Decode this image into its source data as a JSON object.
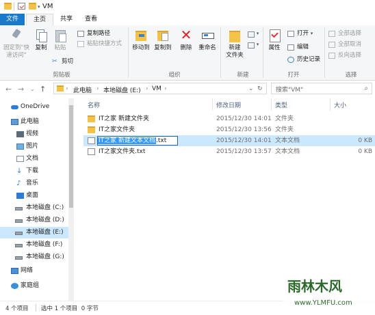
{
  "window": {
    "title": "VM"
  },
  "ribbon_tabs": [
    "文件",
    "主页",
    "共享",
    "查看"
  ],
  "ribbon": {
    "clipboard": {
      "pin_label": "固定到\"快\n速访问\"",
      "copy": "复制",
      "paste": "粘贴",
      "copy_path": "复制路径",
      "paste_shortcut": "粘贴快捷方式",
      "cut": "剪切",
      "group": "剪贴板"
    },
    "organize": {
      "move_to": "移动到",
      "copy_to": "复制到",
      "delete": "删除",
      "rename": "重命名",
      "group": "组织"
    },
    "new": {
      "new_folder": "新建\n文件夹",
      "group": "新建"
    },
    "open": {
      "properties": "属性",
      "open": "打开",
      "edit": "编辑",
      "history": "历史记录",
      "group": "打开"
    },
    "select": {
      "select_all": "全部选择",
      "select_none": "全部取消",
      "invert": "反向选择",
      "group": "选择"
    }
  },
  "address": {
    "crumbs": [
      "此电脑",
      "本地磁盘 (E:)",
      "VM"
    ],
    "search_placeholder": "搜索\"VM\""
  },
  "nav": {
    "items": [
      {
        "label": "OneDrive",
        "icon": "cloud-icon"
      },
      {
        "label": "此电脑",
        "icon": "computer-icon"
      },
      {
        "label": "视频",
        "icon": "video-icon"
      },
      {
        "label": "图片",
        "icon": "picture-icon"
      },
      {
        "label": "文档",
        "icon": "document-icon"
      },
      {
        "label": "下载",
        "icon": "download-icon"
      },
      {
        "label": "音乐",
        "icon": "music-icon"
      },
      {
        "label": "桌面",
        "icon": "desktop-icon"
      },
      {
        "label": "本地磁盘 (C:)",
        "icon": "drive-icon"
      },
      {
        "label": "本地磁盘 (D:)",
        "icon": "drive-icon"
      },
      {
        "label": "本地磁盘 (E:)",
        "icon": "drive-icon"
      },
      {
        "label": "本地磁盘 (F:)",
        "icon": "drive-icon"
      },
      {
        "label": "本地磁盘 (G:)",
        "icon": "drive-icon"
      },
      {
        "label": "网络",
        "icon": "network-icon"
      },
      {
        "label": "家庭组",
        "icon": "homegroup-icon"
      }
    ]
  },
  "columns": {
    "name": "名称",
    "date": "修改日期",
    "type": "类型",
    "size": "大小"
  },
  "files": [
    {
      "name": "IT之家 新建文件夹",
      "date": "2015/12/30 14:01",
      "type": "文件夹",
      "size": ""
    },
    {
      "name": "IT之家文件夹",
      "date": "2015/12/30 13:56",
      "type": "文件夹",
      "size": ""
    },
    {
      "name": "IT之家 新建文本文档.txt",
      "date": "2015/12/30 14:01",
      "type": "文本文档",
      "size": "0 KB"
    },
    {
      "name": "IT之家文件夹.txt",
      "date": "2015/12/30 13:57",
      "type": "文本文档",
      "size": "0 KB"
    }
  ],
  "rename": {
    "selected": "IT之家 新建文本文档",
    "ext": ".txt"
  },
  "status": {
    "count": "4 个项目",
    "selection": "选中 1 个项目  0 字节"
  },
  "watermark": {
    "brand": "雨林木风",
    "url": "www.YLMFU.com"
  }
}
